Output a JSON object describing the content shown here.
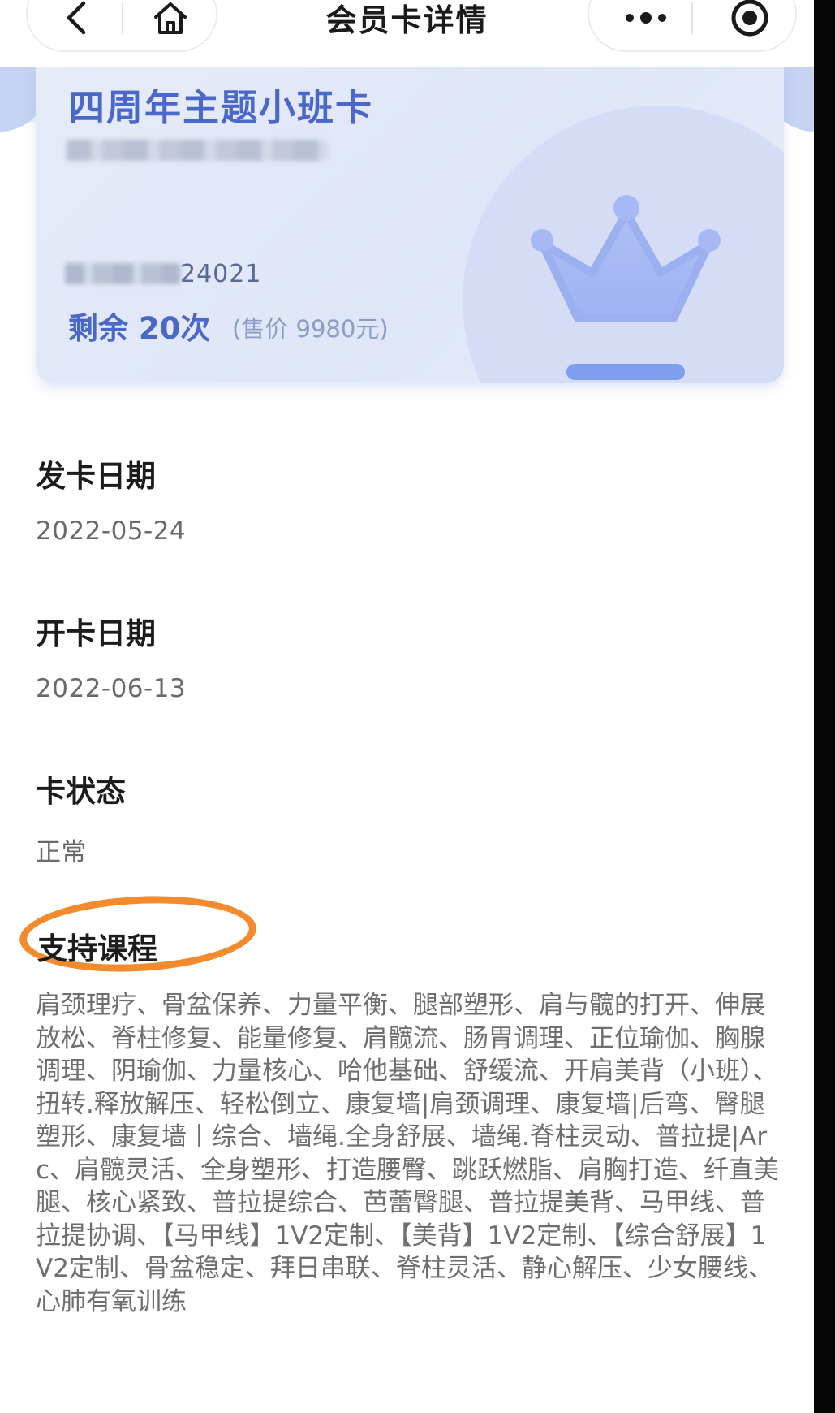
{
  "header": {
    "title": "会员卡详情",
    "back_icon": "chevron-left",
    "home_icon": "home",
    "more_icon": "three-dots",
    "target_icon": "record-target"
  },
  "card": {
    "name": "四周年主题小班卡",
    "number_suffix": "24021",
    "remaining": "剩余 20次",
    "price": "(售价 9980元)",
    "accent_color": "#4a67c9",
    "icon": "crown"
  },
  "fields": [
    {
      "label": "发卡日期",
      "value": "2022-05-24"
    },
    {
      "label": "开卡日期",
      "value": "2022-06-13"
    },
    {
      "label": "卡状态",
      "value": "正常"
    }
  ],
  "courses": {
    "label": "支持课程",
    "highlight_color": "#f28a2e",
    "text": "肩颈理疗、骨盆保养、力量平衡、腿部塑形、肩与髋的打开、伸展放松、脊柱修复、能量修复、肩髋流、肠胃调理、正位瑜伽、胸腺调理、阴瑜伽、力量核心、哈他基础、舒缓流、开肩美背（小班）、扭转.释放解压、轻松倒立、康复墙|肩颈调理、康复墙|后弯、臀腿塑形、康复墙丨综合、墙绳.全身舒展、墙绳.脊柱灵动、普拉提|Arc、肩髋灵活、全身塑形、打造腰臀、跳跃燃脂、肩胸打造、纤直美腿、核心紧致、普拉提综合、芭蕾臀腿、普拉提美背、马甲线、普拉提协调、【马甲线】1V2定制、【美背】1V2定制、【综合舒展】1V2定制、骨盆稳定、拜日串联、脊柱灵活、静心解压、少女腰线、心肺有氧训练"
  }
}
